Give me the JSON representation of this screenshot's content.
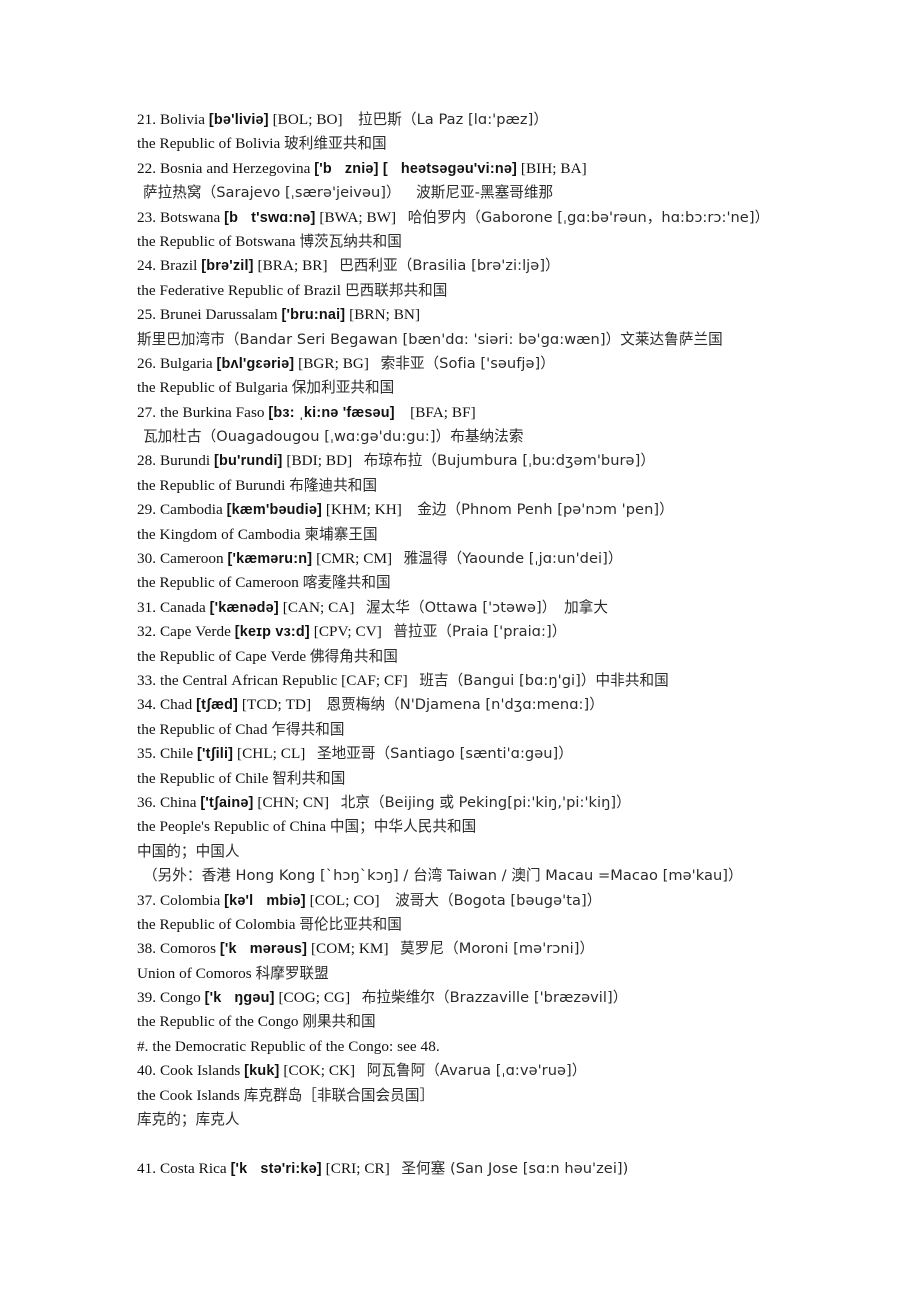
{
  "document": {
    "type": "bilingual-country-reference-list",
    "page_background": "#ffffff",
    "text_color": "#111111",
    "chinese_text_color": "#2b2b2b"
  },
  "lines": [
    {
      "id": "l01",
      "indent": 0,
      "segments": [
        {
          "t": "21. Bolivia ",
          "s": "plain"
        },
        {
          "t": "[bə'liviə]",
          "s": "ipa"
        },
        {
          "t": " [BOL; BO]",
          "s": "plain"
        },
        {
          "t": "    ",
          "s": "plain"
        },
        {
          "t": "拉巴斯（La Paz [lɑ:'pæz]）",
          "s": "cn"
        }
      ],
      "text": "21. Bolivia [bə'liviə] [BOL; BO]    拉巴斯（La Paz [lɑ:'pæz]）"
    },
    {
      "id": "l02",
      "indent": 0,
      "segments": [
        {
          "t": "the Republic of Bolivia ",
          "s": "plain"
        },
        {
          "t": "玻利维亚共和国",
          "s": "cn"
        }
      ],
      "text": "the Republic of Bolivia 玻利维亚共和国"
    },
    {
      "id": "l03",
      "indent": 0,
      "segments": [
        {
          "t": "22. Bosnia and Herzegovina ",
          "s": "plain"
        },
        {
          "t": "['b",
          "s": "ipa"
        },
        {
          "t": "GAP",
          "s": "gap"
        },
        {
          "t": "zniə] [",
          "s": "ipa"
        },
        {
          "t": "GAP",
          "s": "gap"
        },
        {
          "t": "heətsəgəu'vi:nə]",
          "s": "ipa"
        },
        {
          "t": " [BIH; BA]",
          "s": "plain"
        }
      ],
      "text": "22. Bosnia and Herzegovina ['b  zniə] [  heətsəgəu'vi:nə] [BIH; BA]"
    },
    {
      "id": "l04",
      "indent": 1,
      "segments": [
        {
          "t": "萨拉热窝（Sarajevo [ˌsærə'jeivəu]）",
          "s": "cn"
        },
        {
          "t": "    ",
          "s": "plain"
        },
        {
          "t": "波斯尼亚-黑塞哥维那",
          "s": "cn"
        }
      ],
      "text": "萨拉热窝（Sarajevo [ˌsærə'jeivəu]）    波斯尼亚-黑塞哥维那"
    },
    {
      "id": "l05",
      "indent": 0,
      "segments": [
        {
          "t": "23. Botswana ",
          "s": "plain"
        },
        {
          "t": "[b",
          "s": "ipa"
        },
        {
          "t": "GAP",
          "s": "gap"
        },
        {
          "t": "t'swɑ:nə]",
          "s": "ipa"
        },
        {
          "t": " [BWA; BW]",
          "s": "plain"
        },
        {
          "t": "   ",
          "s": "plain"
        },
        {
          "t": "哈伯罗内（Gaborone [ˌgɑ:bə'rəun，hɑ:bɔ:rɔ:'ne]）",
          "s": "cn"
        }
      ],
      "text": "23. Botswana [b  t'swɑ:nə] [BWA; BW]   哈伯罗内（Gaborone [ˌgɑ:bə'rəun，hɑ:bɔ:rɔ:'ne]）"
    },
    {
      "id": "l06",
      "indent": 0,
      "segments": [
        {
          "t": "the Republic of Botswana ",
          "s": "plain"
        },
        {
          "t": "博茨瓦纳共和国",
          "s": "cn"
        }
      ],
      "text": "the Republic of Botswana 博茨瓦纳共和国"
    },
    {
      "id": "l07",
      "indent": 0,
      "segments": [
        {
          "t": "24. Brazil ",
          "s": "plain"
        },
        {
          "t": "[brə'zil]",
          "s": "ipa"
        },
        {
          "t": " [BRA; BR]",
          "s": "plain"
        },
        {
          "t": "   ",
          "s": "plain"
        },
        {
          "t": "巴西利亚（Brasilia [brə'zi:ljə]）",
          "s": "cn"
        }
      ],
      "text": "24. Brazil [brə'zil] [BRA; BR]   巴西利亚（Brasilia [brə'zi:ljə]）"
    },
    {
      "id": "l08",
      "indent": 0,
      "segments": [
        {
          "t": "the Federative Republic of Brazil ",
          "s": "plain"
        },
        {
          "t": "巴西联邦共和国",
          "s": "cn"
        }
      ],
      "text": "the Federative Republic of Brazil 巴西联邦共和国"
    },
    {
      "id": "l09",
      "indent": 0,
      "segments": [
        {
          "t": "25. Brunei Darussalam ",
          "s": "plain"
        },
        {
          "t": "['bru:nai]",
          "s": "ipa"
        },
        {
          "t": " [BRN; BN]",
          "s": "plain"
        }
      ],
      "text": "25. Brunei Darussalam ['bru:nai] [BRN; BN]"
    },
    {
      "id": "l10",
      "indent": 0,
      "segments": [
        {
          "t": "斯里巴加湾市（Bandar Seri Begawan [bæn'dɑ: 'siəri: bə'gɑ:wæn]）文莱达鲁萨兰国",
          "s": "cn"
        }
      ],
      "text": "斯里巴加湾市（Bandar Seri Begawan [bæn'dɑ: 'siəri: bə'gɑ:wæn]）文莱达鲁萨兰国"
    },
    {
      "id": "l11",
      "indent": 0,
      "segments": [
        {
          "t": "26. Bulgaria ",
          "s": "plain"
        },
        {
          "t": "[bʌl'gɛəriə]",
          "s": "ipa"
        },
        {
          "t": " [BGR; BG]",
          "s": "plain"
        },
        {
          "t": "   ",
          "s": "plain"
        },
        {
          "t": "索非亚（Sofia ['səufjə]）",
          "s": "cn"
        }
      ],
      "text": "26. Bulgaria [bʌl'gɛəriə] [BGR; BG]   索非亚（Sofia ['səufjə]）"
    },
    {
      "id": "l12",
      "indent": 0,
      "segments": [
        {
          "t": "the Republic of Bulgaria ",
          "s": "plain"
        },
        {
          "t": "保加利亚共和国",
          "s": "cn"
        }
      ],
      "text": "the Republic of Bulgaria 保加利亚共和国"
    },
    {
      "id": "l13",
      "indent": 0,
      "segments": [
        {
          "t": "27. the Burkina Faso ",
          "s": "plain"
        },
        {
          "t": "[bɜ: ˌki:nə 'fæsəu]",
          "s": "ipa"
        },
        {
          "t": "    [BFA; BF]",
          "s": "plain"
        }
      ],
      "text": "27. the Burkina Faso [bɜ: ˌki:nə 'fæsəu]    [BFA; BF]"
    },
    {
      "id": "l14",
      "indent": 1,
      "segments": [
        {
          "t": "瓦加杜古（Ouagadougou [ˌwɑ:gə'du:gu:]）布基纳法索",
          "s": "cn"
        }
      ],
      "text": "瓦加杜古（Ouagadougou [ˌwɑ:gə'du:gu:]）布基纳法索"
    },
    {
      "id": "l15",
      "indent": 0,
      "segments": [
        {
          "t": "28. Burundi ",
          "s": "plain"
        },
        {
          "t": "[bu'rundi]",
          "s": "ipa"
        },
        {
          "t": " [BDI; BD]",
          "s": "plain"
        },
        {
          "t": "   ",
          "s": "plain"
        },
        {
          "t": "布琼布拉（Bujumbura [ˌbu:dʒəm'burə]）",
          "s": "cn"
        }
      ],
      "text": "28. Burundi [bu'rundi] [BDI; BD]   布琼布拉（Bujumbura [ˌbu:dʒəm'burə]）"
    },
    {
      "id": "l16",
      "indent": 0,
      "segments": [
        {
          "t": "the Republic of Burundi ",
          "s": "plain"
        },
        {
          "t": "布隆迪共和国",
          "s": "cn"
        }
      ],
      "text": "the Republic of Burundi 布隆迪共和国"
    },
    {
      "id": "l17",
      "indent": 0,
      "segments": [
        {
          "t": "29. Cambodia ",
          "s": "plain"
        },
        {
          "t": "[kæm'bəudiə]",
          "s": "ipa"
        },
        {
          "t": " [KHM; KH]",
          "s": "plain"
        },
        {
          "t": "    ",
          "s": "plain"
        },
        {
          "t": "金边（Phnom Penh [pə'nɔm 'pen]）",
          "s": "cn"
        }
      ],
      "text": "29. Cambodia [kæm'bəudiə] [KHM; KH]    金边（Phnom Penh [pə'nɔm 'pen]）"
    },
    {
      "id": "l18",
      "indent": 0,
      "segments": [
        {
          "t": "the Kingdom of Cambodia ",
          "s": "plain"
        },
        {
          "t": "柬埔寨王国",
          "s": "cn"
        }
      ],
      "text": "the Kingdom of Cambodia 柬埔寨王国"
    },
    {
      "id": "l19",
      "indent": 0,
      "segments": [
        {
          "t": "30. Cameroon ",
          "s": "plain"
        },
        {
          "t": "['kæməru:n]",
          "s": "ipa"
        },
        {
          "t": " [CMR; CM]",
          "s": "plain"
        },
        {
          "t": "   ",
          "s": "plain"
        },
        {
          "t": "雅温得（Yaounde [ˌjɑ:un'dei]）",
          "s": "cn"
        }
      ],
      "text": "30. Cameroon ['kæməru:n] [CMR; CM]   雅温得（Yaounde [ˌjɑ:un'dei]）"
    },
    {
      "id": "l20",
      "indent": 0,
      "segments": [
        {
          "t": "the Republic of Cameroon ",
          "s": "plain"
        },
        {
          "t": "喀麦隆共和国",
          "s": "cn"
        }
      ],
      "text": "the Republic of Cameroon 喀麦隆共和国"
    },
    {
      "id": "l21",
      "indent": 0,
      "segments": [
        {
          "t": "31. Canada ",
          "s": "plain"
        },
        {
          "t": "['kænədə]",
          "s": "ipa"
        },
        {
          "t": " [CAN; CA]",
          "s": "plain"
        },
        {
          "t": "   ",
          "s": "plain"
        },
        {
          "t": "渥太华（Ottawa ['ɔtəwə]）",
          "s": "cn"
        },
        {
          "t": "  ",
          "s": "plain"
        },
        {
          "t": "加拿大",
          "s": "cn"
        }
      ],
      "text": "31. Canada ['kænədə] [CAN; CA]   渥太华（Ottawa ['ɔtəwə]）  加拿大"
    },
    {
      "id": "l22",
      "indent": 0,
      "segments": [
        {
          "t": "32. Cape Verde ",
          "s": "plain"
        },
        {
          "t": "[keɪp vɜ:d]",
          "s": "ipa"
        },
        {
          "t": " [CPV; CV]",
          "s": "plain"
        },
        {
          "t": "   ",
          "s": "plain"
        },
        {
          "t": "普拉亚（Praia ['praiɑ:]）",
          "s": "cn"
        }
      ],
      "text": "32. Cape Verde [keɪp vɜ:d] [CPV; CV]   普拉亚（Praia ['praiɑ:]）"
    },
    {
      "id": "l23",
      "indent": 0,
      "segments": [
        {
          "t": "the Republic of Cape Verde ",
          "s": "plain"
        },
        {
          "t": "佛得角共和国",
          "s": "cn"
        }
      ],
      "text": "the Republic of Cape Verde 佛得角共和国"
    },
    {
      "id": "l24",
      "indent": 0,
      "segments": [
        {
          "t": "33. the Central African Republic [CAF; CF]",
          "s": "plain"
        },
        {
          "t": "   ",
          "s": "plain"
        },
        {
          "t": "班吉（Bangui [bɑ:ŋ'gi]）中非共和国",
          "s": "cn"
        }
      ],
      "text": "33. the Central African Republic [CAF; CF]   班吉（Bangui [bɑ:ŋ'gi]）中非共和国"
    },
    {
      "id": "l25",
      "indent": 0,
      "segments": [
        {
          "t": "34. Chad ",
          "s": "plain"
        },
        {
          "t": "[tʃæd]",
          "s": "ipa"
        },
        {
          "t": " [TCD; TD]",
          "s": "plain"
        },
        {
          "t": "    ",
          "s": "plain"
        },
        {
          "t": "恩贾梅纳（N'Djamena [n'dʒɑ:menɑ:]）",
          "s": "cn"
        }
      ],
      "text": "34. Chad [tʃæd] [TCD; TD]    恩贾梅纳（N'Djamena [n'dʒɑ:menɑ:]）"
    },
    {
      "id": "l26",
      "indent": 0,
      "segments": [
        {
          "t": "the Republic of Chad ",
          "s": "plain"
        },
        {
          "t": "乍得共和国",
          "s": "cn"
        }
      ],
      "text": "the Republic of Chad 乍得共和国"
    },
    {
      "id": "l27",
      "indent": 0,
      "segments": [
        {
          "t": "35. Chile ",
          "s": "plain"
        },
        {
          "t": "['tʃili]",
          "s": "ipa"
        },
        {
          "t": " [CHL; CL]",
          "s": "plain"
        },
        {
          "t": "   ",
          "s": "plain"
        },
        {
          "t": "圣地亚哥（Santiago [sænti'ɑ:gəu]）",
          "s": "cn"
        }
      ],
      "text": "35. Chile ['tʃili] [CHL; CL]   圣地亚哥（Santiago [sænti'ɑ:gəu]）"
    },
    {
      "id": "l28",
      "indent": 0,
      "segments": [
        {
          "t": "the Republic of Chile ",
          "s": "plain"
        },
        {
          "t": "智利共和国",
          "s": "cn"
        }
      ],
      "text": "the Republic of Chile 智利共和国"
    },
    {
      "id": "l29",
      "indent": 0,
      "segments": [
        {
          "t": "36. China ",
          "s": "plain"
        },
        {
          "t": "['tʃainə]",
          "s": "ipa"
        },
        {
          "t": " [CHN; CN]",
          "s": "plain"
        },
        {
          "t": "   ",
          "s": "plain"
        },
        {
          "t": "北京（Beijing 或 Peking[pi:'kiŋ,'pi:'kiŋ]）",
          "s": "cn"
        }
      ],
      "text": "36. China ['tʃainə] [CHN; CN]   北京（Beijing 或 Peking[pi:'kiŋ,'pi:'kiŋ]）"
    },
    {
      "id": "l30",
      "indent": 0,
      "segments": [
        {
          "t": "the People's Republic of China ",
          "s": "plain"
        },
        {
          "t": "中国；中华人民共和国",
          "s": "cn"
        }
      ],
      "text": "the People's Republic of China 中国；中华人民共和国"
    },
    {
      "id": "l31",
      "indent": 0,
      "segments": [
        {
          "t": "中国的；中国人",
          "s": "cn"
        }
      ],
      "text": "中国的；中国人"
    },
    {
      "id": "l32",
      "indent": 1,
      "segments": [
        {
          "t": "（另外：香港 Hong Kong [`hɔŋ`kɔŋ] / 台湾 Taiwan / 澳门 Macau =Macao [mə'kau]）",
          "s": "cn"
        }
      ],
      "text": "（另外：香港 Hong Kong [`hɔŋ`kɔŋ] / 台湾 Taiwan / 澳门 Macau =Macao [mə'kau]）"
    },
    {
      "id": "l33",
      "indent": 0,
      "segments": [
        {
          "t": "37. Colombia ",
          "s": "plain"
        },
        {
          "t": "[kə'l",
          "s": "ipa"
        },
        {
          "t": "GAP",
          "s": "gap"
        },
        {
          "t": "mbiə]",
          "s": "ipa"
        },
        {
          "t": " [COL; CO]",
          "s": "plain"
        },
        {
          "t": "    ",
          "s": "plain"
        },
        {
          "t": "波哥大（Bogota [bəugə'ta]）",
          "s": "cn"
        }
      ],
      "text": "37. Colombia [kə'l  mbiə] [COL; CO]    波哥大（Bogota [bəugə'ta]）"
    },
    {
      "id": "l34",
      "indent": 0,
      "segments": [
        {
          "t": "the Republic of Colombia ",
          "s": "plain"
        },
        {
          "t": "哥伦比亚共和国",
          "s": "cn"
        }
      ],
      "text": "the Republic of Colombia 哥伦比亚共和国"
    },
    {
      "id": "l35",
      "indent": 0,
      "segments": [
        {
          "t": "38. Comoros ",
          "s": "plain"
        },
        {
          "t": "['k",
          "s": "ipa"
        },
        {
          "t": "GAP",
          "s": "gap"
        },
        {
          "t": "mərəus]",
          "s": "ipa"
        },
        {
          "t": " [COM; KM]",
          "s": "plain"
        },
        {
          "t": "   ",
          "s": "plain"
        },
        {
          "t": "莫罗尼（Moroni [mə'rɔni]）",
          "s": "cn"
        }
      ],
      "text": "38. Comoros ['k  mərəus] [COM; KM]   莫罗尼（Moroni [mə'rɔni]）"
    },
    {
      "id": "l36",
      "indent": 0,
      "segments": [
        {
          "t": "Union of Comoros ",
          "s": "plain"
        },
        {
          "t": "科摩罗联盟",
          "s": "cn"
        }
      ],
      "text": "Union of Comoros 科摩罗联盟"
    },
    {
      "id": "l37",
      "indent": 0,
      "segments": [
        {
          "t": "39. Congo ",
          "s": "plain"
        },
        {
          "t": "['k",
          "s": "ipa"
        },
        {
          "t": "GAP",
          "s": "gap"
        },
        {
          "t": "ŋgəu]",
          "s": "ipa"
        },
        {
          "t": " [COG; CG]",
          "s": "plain"
        },
        {
          "t": "   ",
          "s": "plain"
        },
        {
          "t": "布拉柴维尔（Brazzaville ['bræzəvil]）",
          "s": "cn"
        }
      ],
      "text": "39. Congo ['k  ŋgəu] [COG; CG]   布拉柴维尔（Brazzaville ['bræzəvil]）"
    },
    {
      "id": "l38",
      "indent": 0,
      "segments": [
        {
          "t": "the Republic of the Congo ",
          "s": "plain"
        },
        {
          "t": "刚果共和国",
          "s": "cn"
        }
      ],
      "text": "the Republic of the Congo 刚果共和国"
    },
    {
      "id": "l39",
      "indent": 0,
      "segments": [
        {
          "t": "#. the Democratic Republic of the Congo: see 48.",
          "s": "plain"
        }
      ],
      "text": "#. the Democratic Republic of the Congo: see 48."
    },
    {
      "id": "l40",
      "indent": 0,
      "segments": [
        {
          "t": "40. Cook Islands ",
          "s": "plain"
        },
        {
          "t": "[kuk]",
          "s": "ipa"
        },
        {
          "t": " [COK; CK]",
          "s": "plain"
        },
        {
          "t": "   ",
          "s": "plain"
        },
        {
          "t": "阿瓦鲁阿（Avarua [ˌɑ:və'ruə]）",
          "s": "cn"
        }
      ],
      "text": "40. Cook Islands [kuk] [COK; CK]   阿瓦鲁阿（Avarua [ˌɑ:və'ruə]）"
    },
    {
      "id": "l41",
      "indent": 0,
      "segments": [
        {
          "t": "the Cook Islands ",
          "s": "plain"
        },
        {
          "t": "库克群岛［非联合国会员国］",
          "s": "cn"
        }
      ],
      "text": "the Cook Islands 库克群岛［非联合国会员国］"
    },
    {
      "id": "l42",
      "indent": 0,
      "segments": [
        {
          "t": "库克的；库克人",
          "s": "cn"
        }
      ],
      "text": "库克的；库克人"
    },
    {
      "id": "l43",
      "indent": 0,
      "blank": true,
      "segments": [],
      "text": ""
    },
    {
      "id": "l44",
      "indent": 0,
      "segments": [
        {
          "t": "41. Costa Rica ",
          "s": "plain"
        },
        {
          "t": "['k",
          "s": "ipa"
        },
        {
          "t": "GAP",
          "s": "gap"
        },
        {
          "t": "stə'ri:kə]",
          "s": "ipa"
        },
        {
          "t": " [CRI; CR]",
          "s": "plain"
        },
        {
          "t": "   ",
          "s": "plain"
        },
        {
          "t": "圣何塞 (San Jose [sɑ:n həu'zei])",
          "s": "cn"
        }
      ],
      "text": "41. Costa Rica ['k  stə'ri:kə] [CRI; CR]   圣何塞 (San Jose [sɑ:n həu'zei])"
    }
  ]
}
